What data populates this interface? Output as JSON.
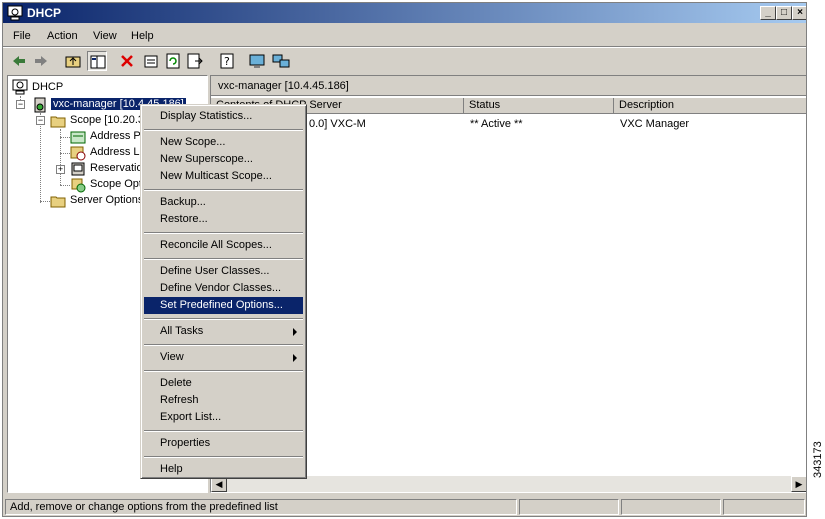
{
  "window": {
    "title": "DHCP"
  },
  "menubar": {
    "items": [
      "File",
      "Action",
      "View",
      "Help"
    ]
  },
  "toolbar": {
    "buttons": [
      "back-icon",
      "forward-icon",
      "up-one-level-icon",
      "show-hide-tree-icon",
      "delete-icon",
      "properties-icon",
      "refresh-icon",
      "export-list-icon",
      "help-icon",
      "console-icon",
      "network-icon"
    ]
  },
  "tree": {
    "root": "DHCP",
    "server": "vxc-manager [10.4.45.186]",
    "scope": "Scope [10.20.3",
    "address_pool": "Address Po",
    "address_leases": "Address Le",
    "reservations": "Reservatio",
    "scope_options": "Scope Opti",
    "server_options": "Server Options"
  },
  "rightpane": {
    "header": "vxc-manager [10.4.45.186]",
    "columns": [
      "Contents of DHCP Server",
      "Status",
      "Description"
    ],
    "rows": [
      {
        "name": "0.0] VXC-M",
        "status": "** Active **",
        "description": "VXC Manager"
      }
    ]
  },
  "context_menu": {
    "items": [
      "Display Statistics...",
      "New Scope...",
      "New Superscope...",
      "New Multicast Scope...",
      "Backup...",
      "Restore...",
      "Reconcile All Scopes...",
      "Define User Classes...",
      "Define Vendor Classes...",
      "Set Predefined Options...",
      "All Tasks",
      "View",
      "Delete",
      "Refresh",
      "Export List...",
      "Properties",
      "Help"
    ],
    "highlighted": "Set Predefined Options..."
  },
  "statusbar": {
    "text": "Add, remove or change options from the predefined list"
  },
  "figure_id": "343173",
  "colors": {
    "titlebar": "#0a246a",
    "highlight": "#0a246a",
    "face": "#d4d0c8"
  }
}
